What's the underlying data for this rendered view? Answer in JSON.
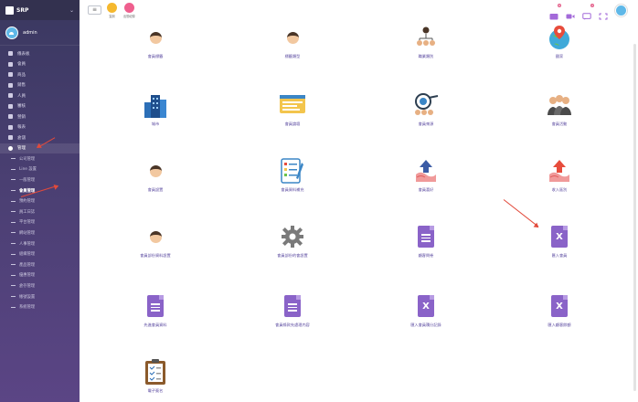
{
  "app": {
    "brand": "SRP",
    "user": "admin"
  },
  "sidebar": {
    "items": [
      {
        "label": "儀表板",
        "icon": "dashboard-icon"
      },
      {
        "label": "會員",
        "icon": "member-icon"
      },
      {
        "label": "商品",
        "icon": "product-icon"
      },
      {
        "label": "銷售",
        "icon": "sales-icon"
      },
      {
        "label": "人員",
        "icon": "staff-icon"
      },
      {
        "label": "審核",
        "icon": "review-icon"
      },
      {
        "label": "營銷",
        "icon": "marketing-icon"
      },
      {
        "label": "報表",
        "icon": "report-icon"
      },
      {
        "label": "倉儲",
        "icon": "warehouse-icon"
      },
      {
        "label": "管理",
        "icon": "gear-icon",
        "active": true
      }
    ],
    "subitems": [
      {
        "label": "公司管理"
      },
      {
        "label": "Line 設置"
      },
      {
        "label": "一般管理"
      },
      {
        "label": "會員管理",
        "active": true
      },
      {
        "label": "預約管理"
      },
      {
        "label": "員工日誌"
      },
      {
        "label": "平台管理"
      },
      {
        "label": "網站管理"
      },
      {
        "label": "人事管理"
      },
      {
        "label": "組織管理"
      },
      {
        "label": "產品管理"
      },
      {
        "label": "優惠管理"
      },
      {
        "label": "倉存管理"
      },
      {
        "label": "帳號設置"
      },
      {
        "label": "系統管理"
      }
    ]
  },
  "topbar": {
    "quick": [
      {
        "label": "簽到",
        "color": "#f5b82e"
      },
      {
        "label": "出勤紀錄",
        "color": "#ef5f8e"
      }
    ],
    "badges": {
      "notifications": "6",
      "messages": "2"
    }
  },
  "tiles": [
    {
      "label": "會員標籤",
      "art": "person-edit"
    },
    {
      "label": "標籤類型",
      "art": "person-edit"
    },
    {
      "label": "職業類別",
      "art": "org-chart"
    },
    {
      "label": "國家",
      "art": "globe-pin"
    },
    {
      "label": "城市",
      "art": "city"
    },
    {
      "label": "會員論壇",
      "art": "forum"
    },
    {
      "label": "會員來源",
      "art": "target-people"
    },
    {
      "label": "會員活動",
      "art": "group"
    },
    {
      "label": "會員設置",
      "art": "person-edit"
    },
    {
      "label": "會員資料補充",
      "art": "checklist"
    },
    {
      "label": "會員喜好",
      "art": "hand-up"
    },
    {
      "label": "收入區別",
      "art": "hand-up"
    },
    {
      "label": "會員部份資料設置",
      "art": "person-edit"
    },
    {
      "label": "會員部份的會設置",
      "art": "gear"
    },
    {
      "label": "顧客問卷",
      "art": "doc"
    },
    {
      "label": "匯入會員",
      "art": "excel"
    },
    {
      "label": "先進會員資料",
      "art": "doc"
    },
    {
      "label": "會員條款先處理內容",
      "art": "doc"
    },
    {
      "label": "匯入會員積分記錄",
      "art": "excel"
    },
    {
      "label": "匯入顧客餘額",
      "art": "excel"
    },
    {
      "label": "電子簽名",
      "art": "clipboard"
    }
  ]
}
